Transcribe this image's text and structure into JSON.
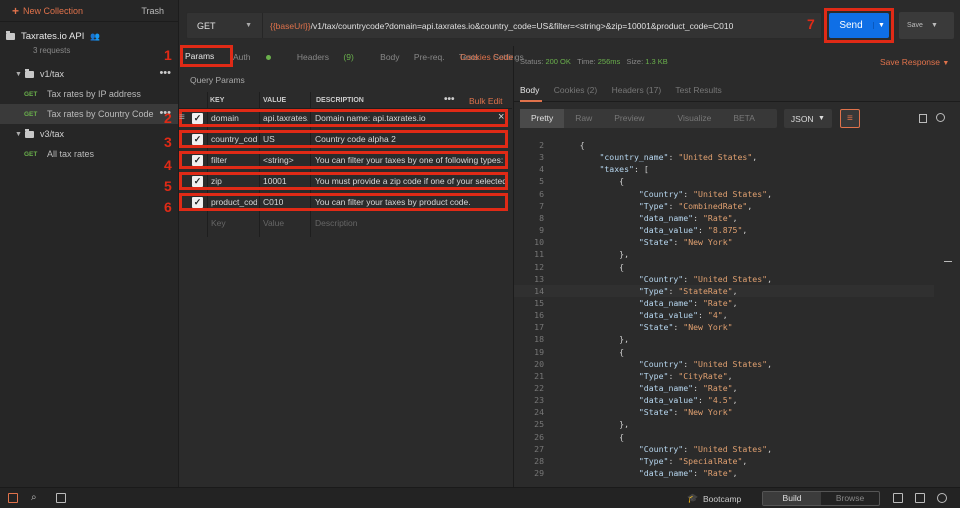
{
  "sidebar": {
    "new_collection": "New Collection",
    "trash": "Trash",
    "collection": {
      "name": "Taxrates.io API",
      "subtitle": "3 requests"
    },
    "folders": [
      {
        "name": "v1/tax",
        "requests": [
          {
            "method": "GET",
            "name": "Tax rates by IP address"
          },
          {
            "method": "GET",
            "name": "Tax rates by Country Code",
            "selected": true
          }
        ]
      },
      {
        "name": "v3/tax",
        "requests": [
          {
            "method": "GET",
            "name": "All tax rates"
          }
        ]
      }
    ]
  },
  "request": {
    "method": "GET",
    "url_var": "{{baseUrl}}",
    "url_rest": "/v1/tax/countrycode?domain=api.taxrates.io&country_code=US&filter=<string>&zip=10001&product_code=C010",
    "send": "Send",
    "save": "Save",
    "tabs": {
      "params": "Params",
      "auth": "Auth",
      "headers": "Headers",
      "headers_count": "(9)",
      "body": "Body",
      "prereq": "Pre-req.",
      "tests": "Tests",
      "settings": "Settings",
      "cookies": "Cookies",
      "code": "Code"
    },
    "query_params_label": "Query Params",
    "columns": {
      "key": "KEY",
      "value": "VALUE",
      "description": "DESCRIPTION",
      "more": "•••",
      "bulk_edit": "Bulk Edit"
    },
    "params": [
      {
        "key": "domain",
        "value": "api.taxrates.io",
        "description": "Domain name: api.taxrates.io"
      },
      {
        "key": "country_code",
        "value": "US",
        "description": "Country code alpha 2"
      },
      {
        "key": "filter",
        "value": "<string>",
        "description": "You can filter your taxes by one of following types: StateRate, CityRate, SpecialRate"
      },
      {
        "key": "zip",
        "value": "10001",
        "description": "You must provide a zip code if one of your selected filters requires it"
      },
      {
        "key": "product_code",
        "value": "C010",
        "description": "You can filter your taxes by product code."
      }
    ],
    "empty_row": {
      "key": "Key",
      "value": "Value",
      "description": "Description"
    }
  },
  "annotations": [
    "1",
    "2",
    "3",
    "4",
    "5",
    "6",
    "7"
  ],
  "response": {
    "status_label": "Status:",
    "status": "200 OK",
    "time_label": "Time:",
    "time": "256ms",
    "size_label": "Size:",
    "size": "1.3 KB",
    "save_response": "Save Response",
    "tabs": {
      "body": "Body",
      "cookies": "Cookies (2)",
      "headers": "Headers (17)",
      "test_results": "Test Results"
    },
    "views": {
      "pretty": "Pretty",
      "raw": "Raw",
      "preview": "Preview",
      "visualize": "Visualize",
      "beta": "BETA"
    },
    "format": "JSON",
    "lines": [
      {
        "n": "2",
        "t": "    {"
      },
      {
        "n": "3",
        "t": "        \"country_name\": \"United States\","
      },
      {
        "n": "4",
        "t": "        \"taxes\": ["
      },
      {
        "n": "5",
        "t": "            {"
      },
      {
        "n": "6",
        "t": "                \"Country\": \"United States\","
      },
      {
        "n": "7",
        "t": "                \"Type\": \"CombinedRate\","
      },
      {
        "n": "8",
        "t": "                \"data_name\": \"Rate\","
      },
      {
        "n": "9",
        "t": "                \"data_value\": \"8.875\","
      },
      {
        "n": "10",
        "t": "                \"State\": \"New York\""
      },
      {
        "n": "11",
        "t": "            },"
      },
      {
        "n": "12",
        "t": "            {"
      },
      {
        "n": "13",
        "t": "                \"Country\": \"United States\","
      },
      {
        "n": "14",
        "t": "                \"Type\": \"StateRate\","
      },
      {
        "n": "15",
        "t": "                \"data_name\": \"Rate\","
      },
      {
        "n": "16",
        "t": "                \"data_value\": \"4\","
      },
      {
        "n": "17",
        "t": "                \"State\": \"New York\""
      },
      {
        "n": "18",
        "t": "            },"
      },
      {
        "n": "19",
        "t": "            {"
      },
      {
        "n": "20",
        "t": "                \"Country\": \"United States\","
      },
      {
        "n": "21",
        "t": "                \"Type\": \"CityRate\","
      },
      {
        "n": "22",
        "t": "                \"data_name\": \"Rate\","
      },
      {
        "n": "23",
        "t": "                \"data_value\": \"4.5\","
      },
      {
        "n": "24",
        "t": "                \"State\": \"New York\""
      },
      {
        "n": "25",
        "t": "            },"
      },
      {
        "n": "26",
        "t": "            {"
      },
      {
        "n": "27",
        "t": "                \"Country\": \"United States\","
      },
      {
        "n": "28",
        "t": "                \"Type\": \"SpecialRate\","
      },
      {
        "n": "29",
        "t": "                \"data_name\": \"Rate\","
      }
    ]
  },
  "bottom": {
    "bootcamp": "Bootcamp",
    "build": "Build",
    "browse": "Browse"
  },
  "colors": {
    "accent": "#e0724b",
    "send": "#0f6fe6",
    "annotation": "#e02a16",
    "get": "#6ab04c"
  }
}
